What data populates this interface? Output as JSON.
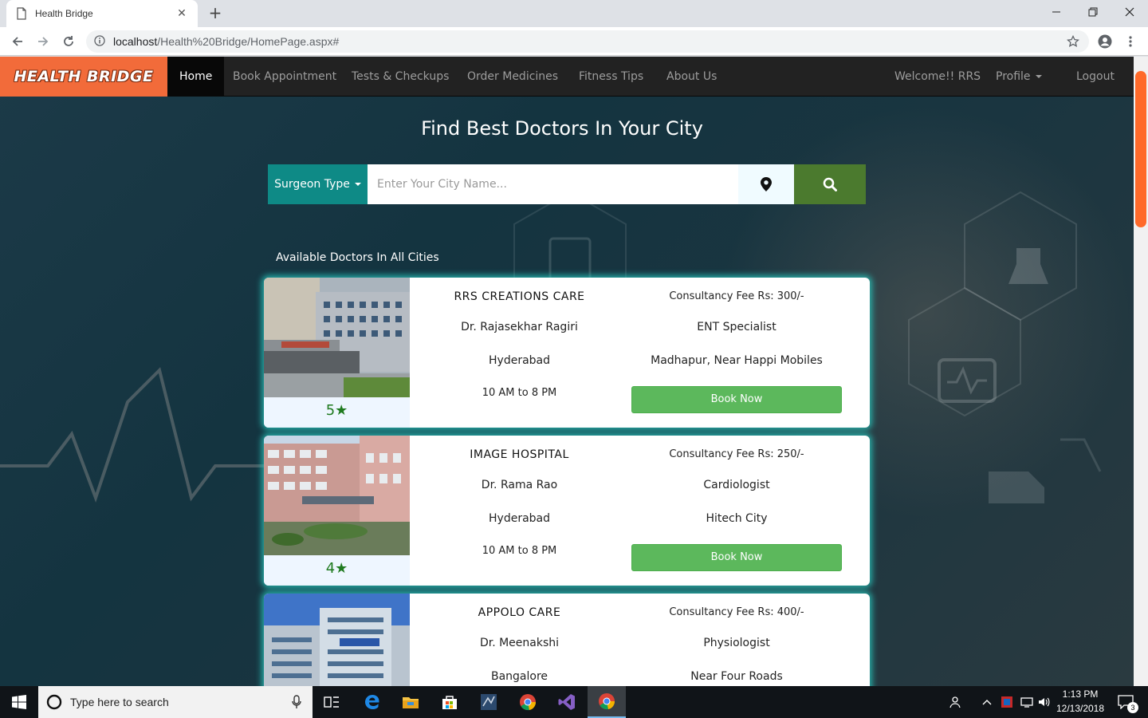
{
  "browser": {
    "tab_title": "Health Bridge",
    "new_tab": "+",
    "url_host": "localhost",
    "url_path": "/Health%20Bridge/HomePage.aspx#"
  },
  "nav": {
    "brand": "HEALTH BRIDGE",
    "items": [
      {
        "label": "Home",
        "active": true
      },
      {
        "label": "Book Appointment"
      },
      {
        "label": "Tests & Checkups"
      },
      {
        "label": "Order Medicines"
      },
      {
        "label": "Fitness Tips"
      },
      {
        "label": "About Us"
      }
    ],
    "welcome": "Welcome!! RRS",
    "profile": "Profile",
    "logout": "Logout"
  },
  "hero": {
    "title": "Find Best Doctors In Your City"
  },
  "search": {
    "surgeon_type": "Surgeon Type",
    "placeholder": "Enter Your City Name...",
    "location_icon": "map-marker-icon",
    "search_icon": "search-icon"
  },
  "listing": {
    "heading": "Available Doctors In All Cities",
    "doctors": [
      {
        "hospital": "RRS CREATIONS CARE",
        "doctor": "Dr. Rajasekhar Ragiri",
        "city": "Hyderabad",
        "timing": "10 AM to 8 PM",
        "fee": "Consultancy Fee Rs: 300/-",
        "specialty": "ENT Specialist",
        "address": "Madhapur, Near Happi Mobiles",
        "rating": "5",
        "book": "Book Now"
      },
      {
        "hospital": "IMAGE HOSPITAL",
        "doctor": "Dr. Rama Rao",
        "city": "Hyderabad",
        "timing": "10 AM to 8 PM",
        "fee": "Consultancy Fee Rs: 250/-",
        "specialty": "Cardiologist",
        "address": "Hitech City",
        "rating": "4",
        "book": "Book Now"
      },
      {
        "hospital": "APPOLO CARE",
        "doctor": "Dr. Meenakshi",
        "city": "Bangalore",
        "timing": "",
        "fee": "Consultancy Fee Rs: 400/-",
        "specialty": "Physiologist",
        "address": "Near Four Roads",
        "rating": "",
        "book": ""
      }
    ]
  },
  "taskbar": {
    "search_placeholder": "Type here to search",
    "time": "1:13 PM",
    "date": "12/13/2018",
    "notifications": "3"
  },
  "colors": {
    "brand": "#f26b3a",
    "navbar": "#222222",
    "surgeon_button": "#0e8a86",
    "search_button": "#4b7a2e",
    "book_button": "#5cb85c",
    "card_glow": "#28c8be"
  }
}
